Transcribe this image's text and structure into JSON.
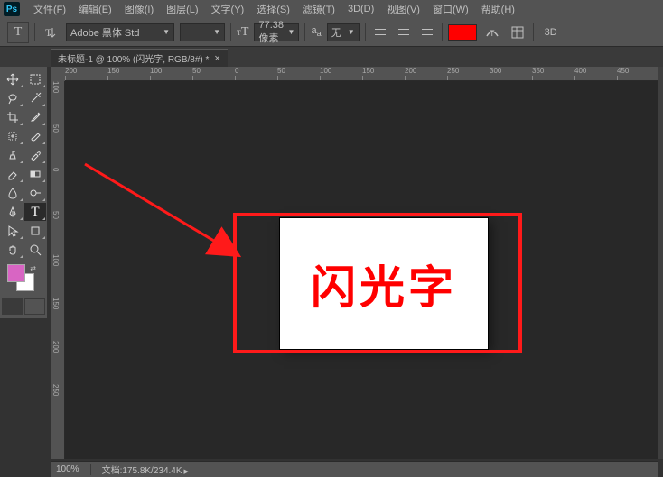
{
  "app": {
    "name": "Ps"
  },
  "menu": [
    "文件(F)",
    "编辑(E)",
    "图像(I)",
    "图层(L)",
    "文字(Y)",
    "选择(S)",
    "滤镜(T)",
    "3D(D)",
    "视图(V)",
    "窗口(W)",
    "帮助(H)"
  ],
  "options": {
    "font_family": "Adobe 黑体 Std",
    "font_style": "",
    "font_size": "77.38 像素",
    "antialias": "无",
    "color": "#ff0000",
    "threed_label": "3D"
  },
  "document": {
    "tab_title": "未标题-1 @ 100% (闪光字, RGB/8#) *",
    "canvas_text": "闪光字"
  },
  "ruler_h": [
    "200",
    "150",
    "100",
    "50",
    "0",
    "50",
    "100",
    "150",
    "200",
    "250",
    "300",
    "350",
    "400",
    "450"
  ],
  "ruler_v": [
    "100",
    "50",
    "0",
    "50",
    "100",
    "150",
    "200",
    "250"
  ],
  "status": {
    "zoom": "100%",
    "doc_info": "文档:175.8K/234.4K"
  },
  "toolbox": {
    "fg_color": "#d865c3",
    "bg_color": "#ffffff"
  }
}
